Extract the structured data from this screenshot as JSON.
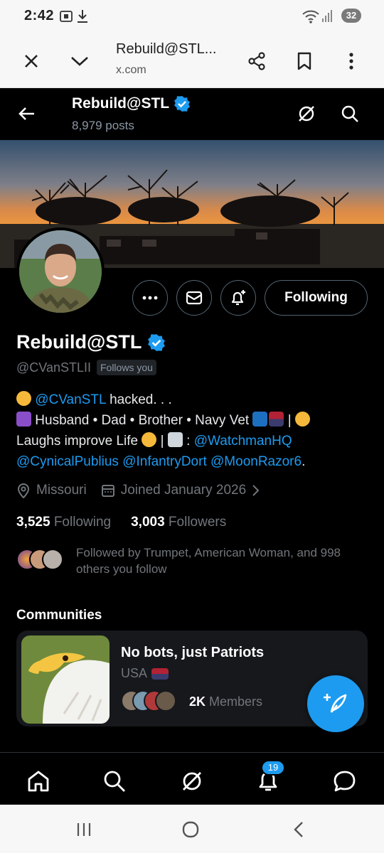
{
  "status_bar": {
    "time": "2:42",
    "battery": "32"
  },
  "browser": {
    "title": "Rebuild@STL...",
    "url": "x.com"
  },
  "header": {
    "name": "Rebuild@STL",
    "posts": "8,979 posts"
  },
  "profile": {
    "name": "Rebuild@STL",
    "handle": "@CVanSTLII",
    "follows_you": "Follows you",
    "following_label": "Following",
    "bio": {
      "line1_link": "@CVanSTL",
      "line1_text": " hacked. . .",
      "line2_text": " Husband • Dad • Brother • Navy Vet ",
      "line3_text": "Laughs improve Life ",
      "line3_sep": " | ",
      "line3_colon": " : ",
      "links": [
        "@WatchmanHQ",
        "@CynicalPublius",
        "@InfantryDort",
        "@MoonRazor6"
      ],
      "end": "."
    },
    "location": "Missouri",
    "joined": "Joined January 2026",
    "following_count": "3,525",
    "following_label2": "Following",
    "followers_count": "3,003",
    "followers_label": "Followers",
    "followed_by": "Followed by Trumpet, American Woman, and 998 others you follow"
  },
  "communities": {
    "title": "Communities",
    "items": [
      {
        "name": "No bots, just Patriots",
        "country": "USA",
        "members_count": "2K",
        "members_label": "Members"
      }
    ]
  },
  "notifications_badge": "19",
  "colors": {
    "accent": "#1d9bf0",
    "background": "#000000",
    "muted": "#71767b"
  }
}
